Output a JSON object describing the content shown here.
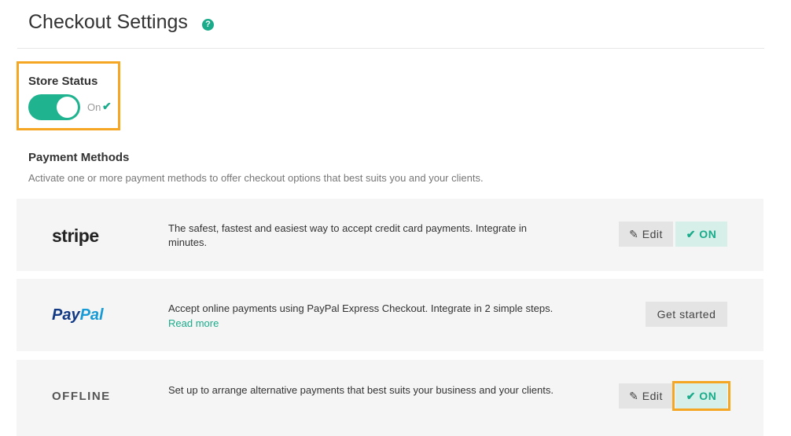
{
  "header": {
    "title": "Checkout Settings",
    "help_icon": "?"
  },
  "store_status": {
    "label": "Store Status",
    "state_label": "On",
    "check_icon": "✔",
    "enabled": true
  },
  "payment_methods": {
    "title": "Payment Methods",
    "description": "Activate one or more payment methods to offer checkout options that best suits you and your clients.",
    "stripe": {
      "logo": "stripe",
      "description": "The safest, fastest and easiest way to accept credit card payments. Integrate in minutes.",
      "edit_label": "✎ Edit",
      "on_label": "✔ ON"
    },
    "paypal": {
      "logo_pay": "Pay",
      "logo_pal": "Pal",
      "description": "Accept online payments using PayPal Express Checkout. Integrate in 2 simple steps.",
      "read_more": "Read more",
      "get_started_label": "Get started"
    },
    "offline": {
      "logo": "OFFLINE",
      "description": "Set up to arrange alternative payments that best suits your business and your clients.",
      "edit_label": "✎ Edit",
      "on_label": "✔ ON"
    }
  },
  "colors": {
    "accent": "#1aab8a",
    "highlight": "#f5a623",
    "row_background": "#f5f5f5"
  }
}
